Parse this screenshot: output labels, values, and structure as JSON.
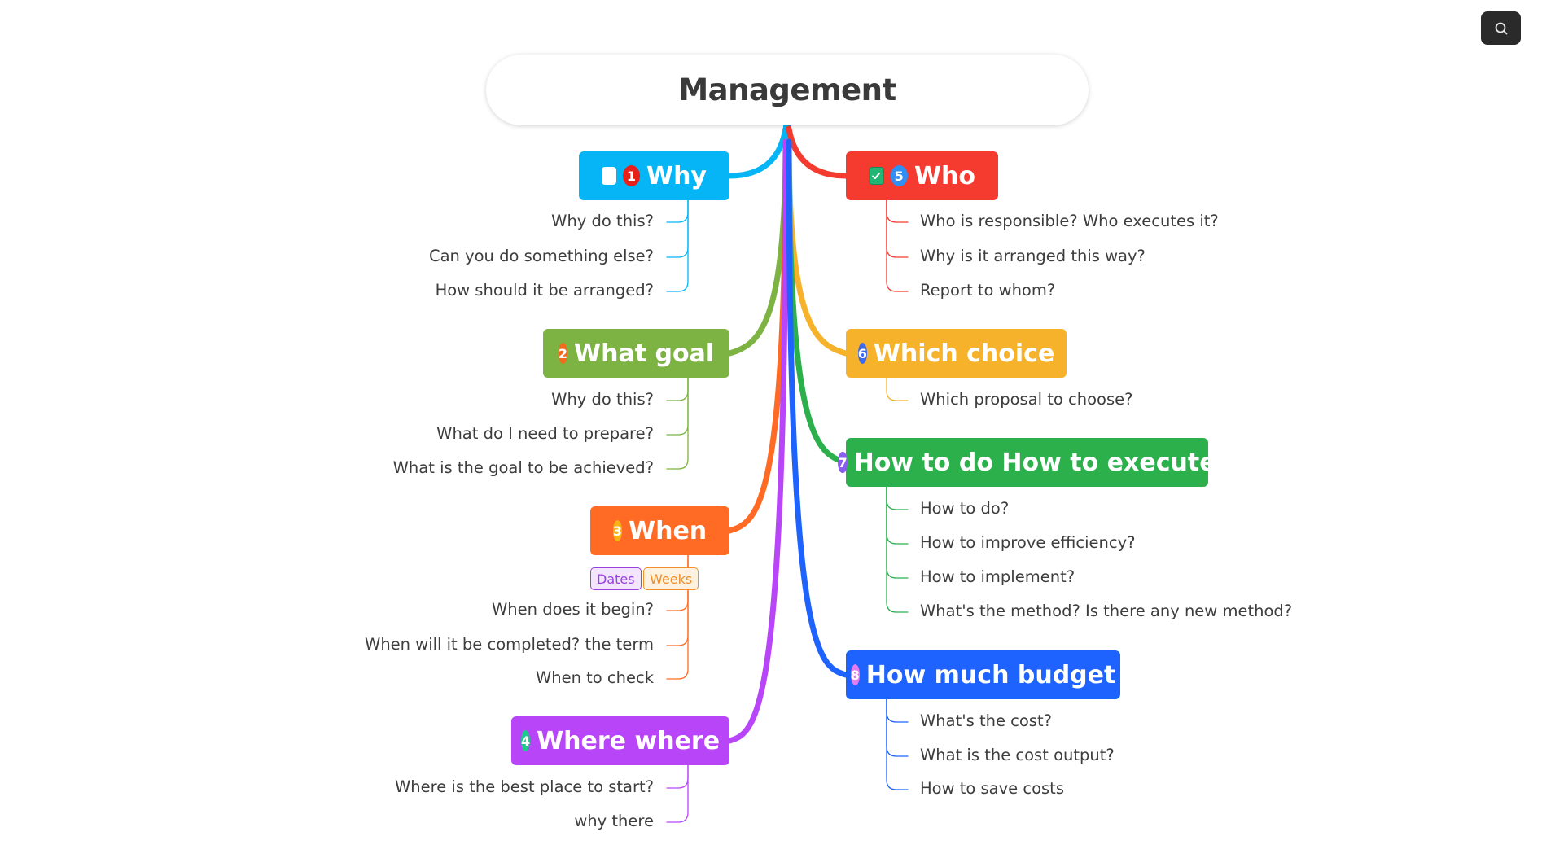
{
  "toolbar": {
    "search_icon": "search-icon"
  },
  "root": {
    "title": "Management"
  },
  "branches": [
    {
      "id": "why",
      "label": "Why",
      "number": "1",
      "color": "#05b5f5",
      "badge_color": "#e8201a",
      "checkbox": "unchecked",
      "side": "left",
      "children": [
        "Why do this?",
        "Can you do something else?",
        "How should it be arranged?"
      ]
    },
    {
      "id": "what-goal",
      "label": "What goal",
      "number": "2",
      "color": "#7cb342",
      "badge_color": "#f26b1d",
      "side": "left",
      "children": [
        "Why do this?",
        "What do I need to prepare?",
        "What is the goal to be achieved?"
      ]
    },
    {
      "id": "when",
      "label": "When",
      "number": "3",
      "color": "#ff6b24",
      "badge_color": "#f7b218",
      "side": "left",
      "tags": [
        {
          "label": "Dates",
          "color": "#9b3fe0",
          "bg": "#f2e5fc"
        },
        {
          "label": "Weeks",
          "color": "#f0902a",
          "bg": "#fff1e0"
        }
      ],
      "children": [
        "When does it begin?",
        "When will it be completed? the term",
        "When to check"
      ]
    },
    {
      "id": "where",
      "label": "Where where",
      "number": "4",
      "color": "#b846f8",
      "badge_color": "#1fc98c",
      "side": "left",
      "children": [
        "Where is the best place to start?",
        "why there"
      ]
    },
    {
      "id": "who",
      "label": "Who",
      "number": "5",
      "color": "#f53a2f",
      "badge_color": "#2f8ff5",
      "checkbox": "checked",
      "side": "right",
      "children": [
        "Who is responsible? Who executes it?",
        "Why is it arranged this way?",
        "Report to whom?"
      ]
    },
    {
      "id": "which-choice",
      "label": "Which choice",
      "number": "6",
      "color": "#f5b22a",
      "badge_color": "#3d6bf0",
      "side": "right",
      "children": [
        "Which proposal to choose?"
      ]
    },
    {
      "id": "how-to",
      "label": "How to do How to execute",
      "number": "7",
      "color": "#2bb04c",
      "badge_color": "#8a5cf0",
      "side": "right",
      "children": [
        "How to do?",
        "How to improve efficiency?",
        "How to implement?",
        "What's the method? Is there any new method?"
      ]
    },
    {
      "id": "budget",
      "label": "How much budget",
      "number": "8",
      "color": "#1f63ff",
      "badge_color": "#e57cf0",
      "side": "right",
      "children": [
        "What's the cost?",
        "What is the cost output?",
        "How to save costs"
      ]
    }
  ]
}
